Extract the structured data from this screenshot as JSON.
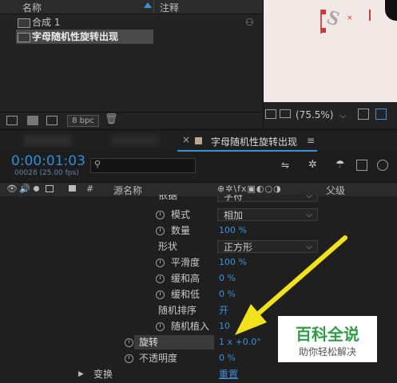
{
  "project": {
    "col_name": "名称",
    "col_comment": "注释",
    "items": [
      {
        "label": "合成 1"
      },
      {
        "label": "字母随机性旋转出现"
      }
    ],
    "bpc": "8 bpc"
  },
  "viewer": {
    "zoom": "(75.5%)",
    "canvas_letter": "S"
  },
  "timeline": {
    "tab_title": "字母随机性旋转出现",
    "tab_menu": "≡",
    "timecode": "0:00:01:03",
    "frame_info": "00028 (25.00 fps)",
    "search_placeholder": "",
    "columns": {
      "source_name": "源名称",
      "hash": "#",
      "parent": "父级"
    },
    "properties": [
      {
        "label": "依据",
        "value": "字符",
        "kind": "dropdown"
      },
      {
        "label": "模式",
        "value": "相加",
        "kind": "dropdown"
      },
      {
        "label": "数量",
        "value": "100 %",
        "kind": "value"
      },
      {
        "label": "形状",
        "value": "正方形",
        "kind": "dropdown"
      },
      {
        "label": "平滑度",
        "value": "100 %",
        "kind": "value"
      },
      {
        "label": "缓和高",
        "value": "0 %",
        "kind": "value"
      },
      {
        "label": "缓和低",
        "value": "0 %",
        "kind": "value"
      },
      {
        "label": "随机排序",
        "value": "开",
        "kind": "value"
      },
      {
        "label": "随机植入",
        "value": "10",
        "kind": "value"
      },
      {
        "label": "旋转",
        "value": "1 x +0.0°",
        "kind": "value"
      },
      {
        "label": "不透明度",
        "value": "0 %",
        "kind": "value"
      },
      {
        "label": "变换",
        "value": "重置",
        "kind": "link"
      }
    ]
  },
  "watermark": {
    "title": "百科全说",
    "subtitle": "助你轻松解决"
  },
  "colors": {
    "accent_blue": "#3f8fd5",
    "arrow_yellow": "#f2e21c",
    "watermark_green": "#2e9e44"
  }
}
